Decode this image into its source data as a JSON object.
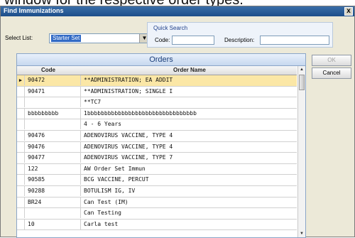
{
  "caption": "window for the respective order types.",
  "window": {
    "title": "Find Immunizations",
    "close_glyph": "x"
  },
  "select_list": {
    "label": "Select List:",
    "value": "Starter Set",
    "arrow": "▼"
  },
  "quick_search": {
    "header": "Quick Search",
    "code_label": "Code:",
    "code_value": "",
    "description_label": "Description:",
    "description_value": ""
  },
  "buttons": {
    "ok": "OK",
    "cancel": "Cancel"
  },
  "grid": {
    "title": "Orders",
    "columns": {
      "code": "Code",
      "name": "Order Name"
    },
    "rows": [
      {
        "code": "90472",
        "name": "**ADMINISTRATION; EA ADDIT",
        "selected": true
      },
      {
        "code": "90471",
        "name": "**ADMINISTRATION; SINGLE I"
      },
      {
        "code": "",
        "name": "**TC7"
      },
      {
        "code": "bbbbbbbbb",
        "name": "1bbbbbbbbbbbbbbbbbbbbbbbbbbbbbbbb"
      },
      {
        "code": "",
        "name": "4 - 6 Years"
      },
      {
        "code": "90476",
        "name": "ADENOVIRUS VACCINE, TYPE 4"
      },
      {
        "code": "90476",
        "name": "ADENOVIRUS VACCINE, TYPE 4"
      },
      {
        "code": "90477",
        "name": "ADENOVIRUS VACCINE, TYPE 7"
      },
      {
        "code": "122",
        "name": "AW Order Set Immun"
      },
      {
        "code": "90585",
        "name": "BCG VACCINE, PERCUT"
      },
      {
        "code": "90288",
        "name": "BOTULISM IG, IV"
      },
      {
        "code": "BR24",
        "name": "Can Test (IM)"
      },
      {
        "code": "",
        "name": "Can Testing"
      },
      {
        "code": "10",
        "name": "Carla test"
      }
    ],
    "selected_marker": "▶",
    "scroll_up": "▲",
    "scroll_down": "▼"
  }
}
